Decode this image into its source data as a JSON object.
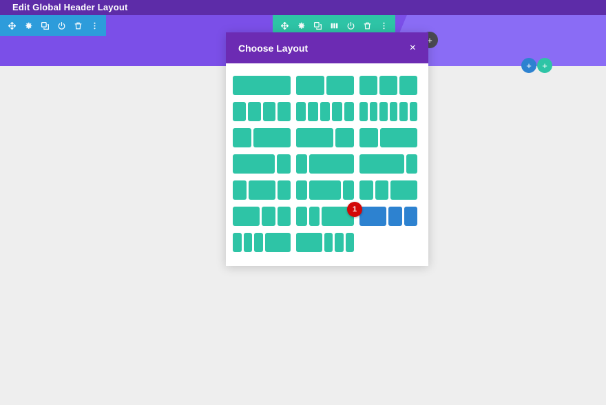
{
  "page": {
    "title": "Edit Global Header Layout",
    "background_color": "#eeeeee",
    "hero_color": "#7b4fe8",
    "hero_strip_color": "#5d2ca8",
    "hero_wedge_color": "#8a6cf5"
  },
  "section_toolbar": {
    "name": "section-toolbar",
    "background_color": "#2d9cdb",
    "icons": [
      {
        "name": "move-icon",
        "glyph": "move"
      },
      {
        "name": "gear-icon",
        "glyph": "gear"
      },
      {
        "name": "duplicate-icon",
        "glyph": "duplicate"
      },
      {
        "name": "power-icon",
        "glyph": "power"
      },
      {
        "name": "trash-icon",
        "glyph": "trash"
      },
      {
        "name": "more-options-icon",
        "glyph": "dots"
      }
    ]
  },
  "row_toolbar": {
    "name": "row-toolbar",
    "background_color": "#2ec4a6",
    "icons": [
      {
        "name": "move-icon",
        "glyph": "move"
      },
      {
        "name": "gear-icon",
        "glyph": "gear"
      },
      {
        "name": "duplicate-icon",
        "glyph": "duplicate"
      },
      {
        "name": "columns-icon",
        "glyph": "columns"
      },
      {
        "name": "power-icon",
        "glyph": "power"
      },
      {
        "name": "trash-icon",
        "glyph": "trash"
      },
      {
        "name": "more-options-icon",
        "glyph": "dots"
      }
    ]
  },
  "floating_buttons": [
    {
      "name": "add-section-gray-button",
      "label": "+",
      "color": "#4a4a52"
    },
    {
      "name": "add-row-blue-button",
      "label": "+",
      "color": "#2d82d0"
    },
    {
      "name": "add-module-green-button",
      "label": "+",
      "color": "#2ec4a6"
    }
  ],
  "modal": {
    "title": "Choose Layout",
    "close_label": "×",
    "header_color": "#6c2bb3",
    "body_color": "#ffffff",
    "option_color": "#2ec4a6",
    "selected_color": "#2d82d0",
    "badge": {
      "name": "step-badge-1",
      "label": "1",
      "color": "#d30808"
    },
    "rows": [
      {
        "options": [
          {
            "name": "layout-1-column",
            "columns": [
              1
            ],
            "selected": false
          },
          {
            "name": "layout-2-columns",
            "columns": [
              1,
              1
            ],
            "selected": false
          },
          {
            "name": "layout-3-columns",
            "columns": [
              1,
              1,
              1
            ],
            "selected": false
          }
        ]
      },
      {
        "options": [
          {
            "name": "layout-4-columns",
            "columns": [
              1,
              1,
              1,
              1
            ],
            "selected": false
          },
          {
            "name": "layout-5-columns",
            "columns": [
              1,
              1,
              1,
              1,
              1
            ],
            "selected": false
          },
          {
            "name": "layout-6-columns",
            "columns": [
              1,
              1,
              1,
              1,
              1,
              1
            ],
            "selected": false
          }
        ]
      },
      {
        "options": [
          {
            "name": "layout-one-third-two-thirds",
            "columns": [
              1,
              2
            ],
            "selected": false
          },
          {
            "name": "layout-two-thirds-one-third",
            "columns": [
              2,
              1
            ],
            "selected": false
          },
          {
            "name": "layout-one-quarter-three-quarters",
            "columns": [
              1,
              2
            ],
            "selected": false
          }
        ]
      },
      {
        "options": [
          {
            "name": "layout-three-quarters-one-quarter",
            "columns": [
              3,
              1
            ],
            "selected": false
          },
          {
            "name": "layout-one-sixth-five-sixths",
            "columns": [
              1,
              4
            ],
            "selected": false
          },
          {
            "name": "layout-five-sixths-one-sixth",
            "columns": [
              4,
              1
            ],
            "selected": false
          }
        ]
      },
      {
        "options": [
          {
            "name": "layout-quarter-half-quarter",
            "columns": [
              1,
              2,
              1
            ],
            "selected": false
          },
          {
            "name": "layout-sixth-two-thirds-sixth",
            "columns": [
              1,
              3,
              1
            ],
            "selected": false
          },
          {
            "name": "layout-quarter-quarter-half",
            "columns": [
              1,
              1,
              2
            ],
            "selected": false
          }
        ]
      },
      {
        "options": [
          {
            "name": "layout-half-quarter-quarter",
            "columns": [
              2,
              1,
              1
            ],
            "selected": false
          },
          {
            "name": "layout-sixth-sixth-two-thirds",
            "columns": [
              1,
              1,
              3
            ],
            "selected": false
          },
          {
            "name": "layout-half-quarter-quarter-selected",
            "columns": [
              2,
              1,
              1
            ],
            "selected": true
          }
        ]
      },
      {
        "options": [
          {
            "name": "layout-sixth-sixth-sixth-half",
            "columns": [
              1,
              1,
              1,
              3
            ],
            "selected": false
          },
          {
            "name": "layout-half-sixth-sixth-sixth",
            "columns": [
              3,
              1,
              1,
              1
            ],
            "selected": false
          }
        ]
      }
    ]
  }
}
